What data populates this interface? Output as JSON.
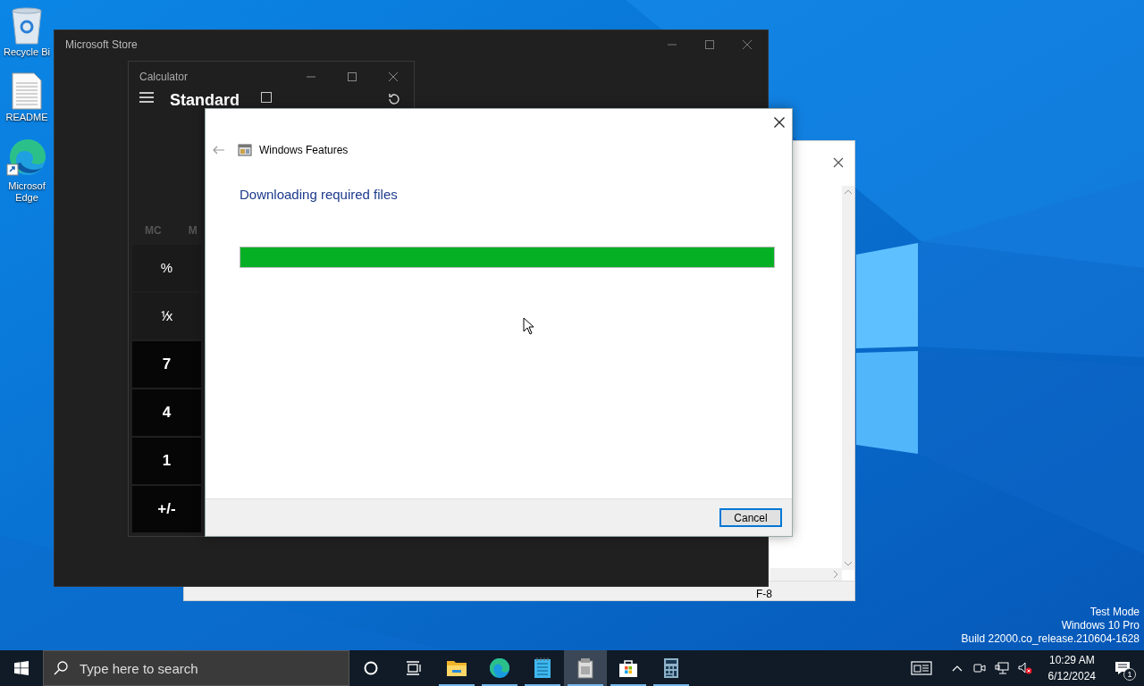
{
  "desktop_icons": [
    {
      "kind": "recycle",
      "label": "Recycle Bi"
    },
    {
      "kind": "document",
      "label": "README"
    },
    {
      "kind": "edge",
      "label": "Microsof Edge"
    }
  ],
  "store_window": {
    "title": "Microsoft Store"
  },
  "notepad_window": {
    "status_text": "F-8"
  },
  "calculator": {
    "title": "Calculator",
    "mode": "Standard",
    "memory_buttons": [
      "MC",
      "M"
    ],
    "keys": [
      {
        "label": "%",
        "kind": "function"
      },
      {
        "label": "⅟x",
        "kind": "function"
      },
      {
        "label": "7",
        "kind": "number"
      },
      {
        "label": "4",
        "kind": "number"
      },
      {
        "label": "1",
        "kind": "number"
      },
      {
        "label": "+/-",
        "kind": "number"
      }
    ]
  },
  "dialog": {
    "title": "Windows Features",
    "heading": "Downloading required files",
    "progress": {
      "level": 1
    },
    "buttons": [
      "Cancel"
    ]
  },
  "watermark": [
    "Test Mode",
    "Windows 10 Pro",
    "Build 22000.co_release.210604-1628"
  ],
  "taskbar": {
    "search": {
      "placeholder": "Type here to search"
    },
    "apps": [
      {
        "kind": "cortana",
        "running": false,
        "selected": false
      },
      {
        "kind": "taskview",
        "running": false,
        "selected": false
      },
      {
        "kind": "explorer",
        "running": true,
        "selected": false
      },
      {
        "kind": "edge",
        "running": true,
        "selected": false
      },
      {
        "kind": "notepad",
        "running": true,
        "selected": false
      },
      {
        "kind": "features",
        "running": true,
        "selected": true
      },
      {
        "kind": "store",
        "running": true,
        "selected": false
      },
      {
        "kind": "calculator",
        "running": true,
        "selected": false
      }
    ],
    "clock": {
      "time": "10:29 AM",
      "date": "6/12/2024"
    },
    "notification_count": "1"
  }
}
